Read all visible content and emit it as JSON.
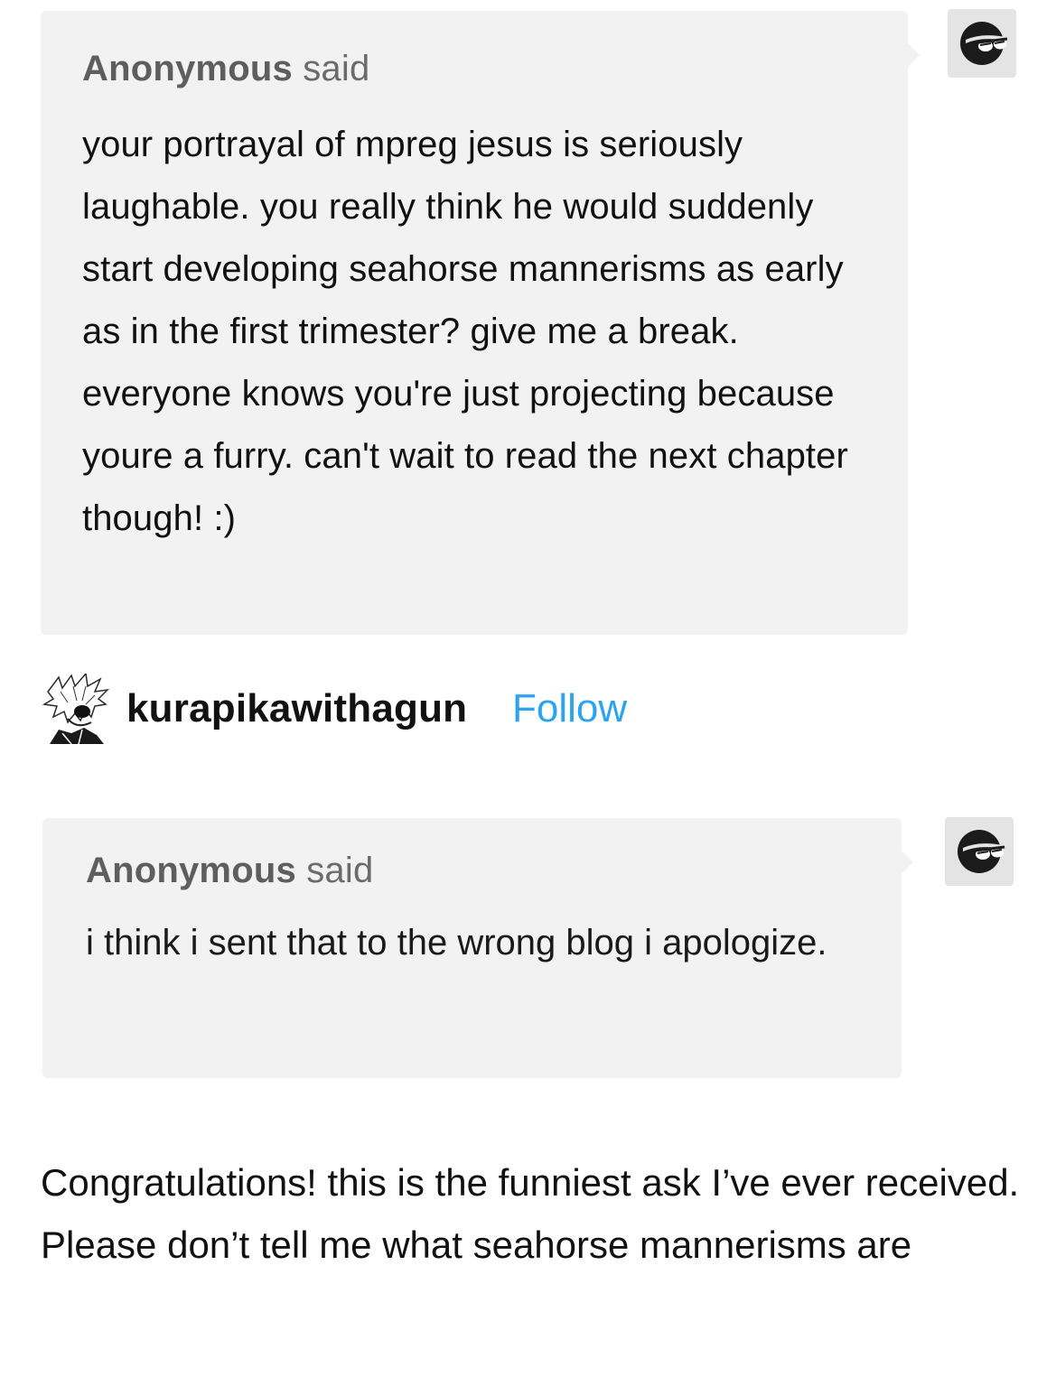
{
  "ask1": {
    "asker_name": "Anonymous",
    "asker_suffix": " said",
    "question": "your portrayal of mpreg jesus is seriously laughable. you really think he would suddenly start developing seahorse mannerisms as early as in the first trimester? give me a break. everyone knows you're just projecting because youre a furry. can't wait to read the next chapter though! :)",
    "avatar_icon": "sunglasses-anon-icon"
  },
  "user": {
    "username": "kurapikawithagun",
    "follow_label": "Follow",
    "avatar_icon": "manga-avatar"
  },
  "ask2": {
    "asker_name": "Anonymous",
    "asker_suffix": " said",
    "question": "i think i sent that to the wrong blog i apologize.",
    "avatar_icon": "sunglasses-anon-icon"
  },
  "answer": {
    "text": "Congratulations! this is the funniest ask I’ve ever received. Please don’t tell me what seahorse mannerisms are"
  },
  "colors": {
    "ask_background": "#f2f2f2",
    "follow_link": "#2aa4ef",
    "asker_gray": "#6b6b6b"
  }
}
